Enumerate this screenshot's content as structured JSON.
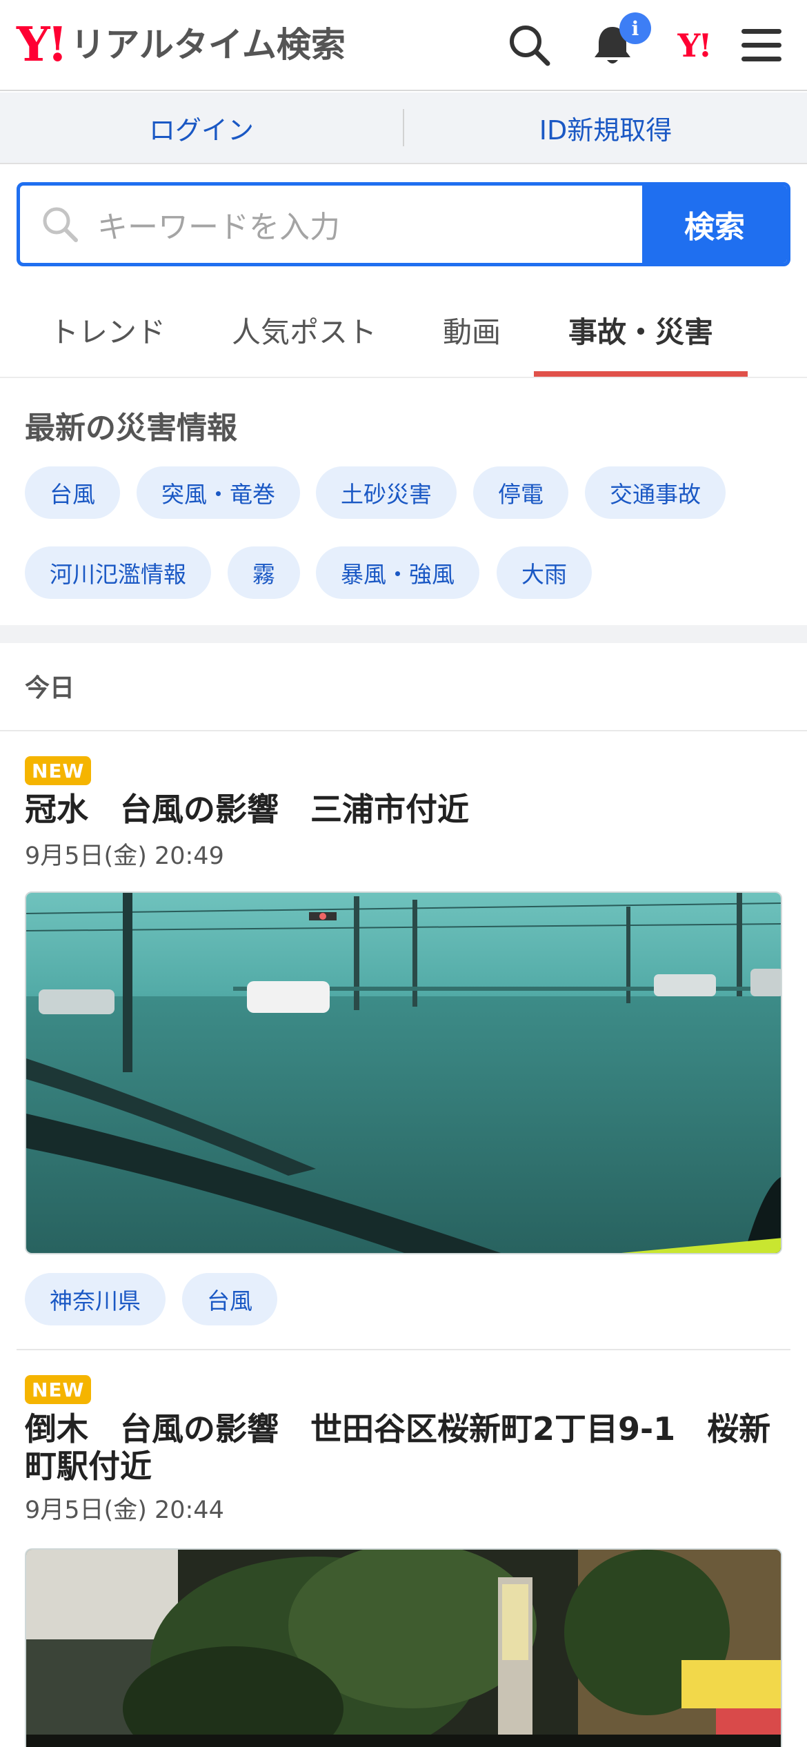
{
  "header": {
    "logo_mark": "Y!",
    "logo_text": "リアルタイム検索",
    "notification_count": "i",
    "yahoo_mark": "Y!"
  },
  "loginbar": {
    "login": "ログイン",
    "register": "ID新規取得"
  },
  "search": {
    "placeholder": "キーワードを入力",
    "button": "検索"
  },
  "tabs": [
    {
      "label": "トレンド",
      "active": false
    },
    {
      "label": "人気ポスト",
      "active": false
    },
    {
      "label": "動画",
      "active": false
    },
    {
      "label": "事故・災害",
      "active": true
    }
  ],
  "disaster": {
    "title": "最新の災害情報",
    "chips": [
      "台風",
      "突風・竜巻",
      "土砂災害",
      "停電",
      "交通事故",
      "河川氾濫情報",
      "霧",
      "暴風・強風",
      "大雨"
    ]
  },
  "timeline": {
    "day_label": "今日"
  },
  "posts": [
    {
      "badge": "NEW",
      "title": "冠水　台風の影響　三浦市付近",
      "time": "9月5日(金) 20:49",
      "tags": [
        "神奈川県",
        "台風"
      ]
    },
    {
      "badge": "NEW",
      "title": "倒木　台風の影響　世田谷区桜新町2丁目9-1　桜新町駅付近",
      "time": "9月5日(金) 20:44",
      "tags": []
    }
  ],
  "colors": {
    "accent": "#1f6ff0",
    "brand_red": "#ff0033",
    "tab_underline": "#e0514a",
    "chip_bg": "#e6effc",
    "new_badge": "#f5b400"
  }
}
